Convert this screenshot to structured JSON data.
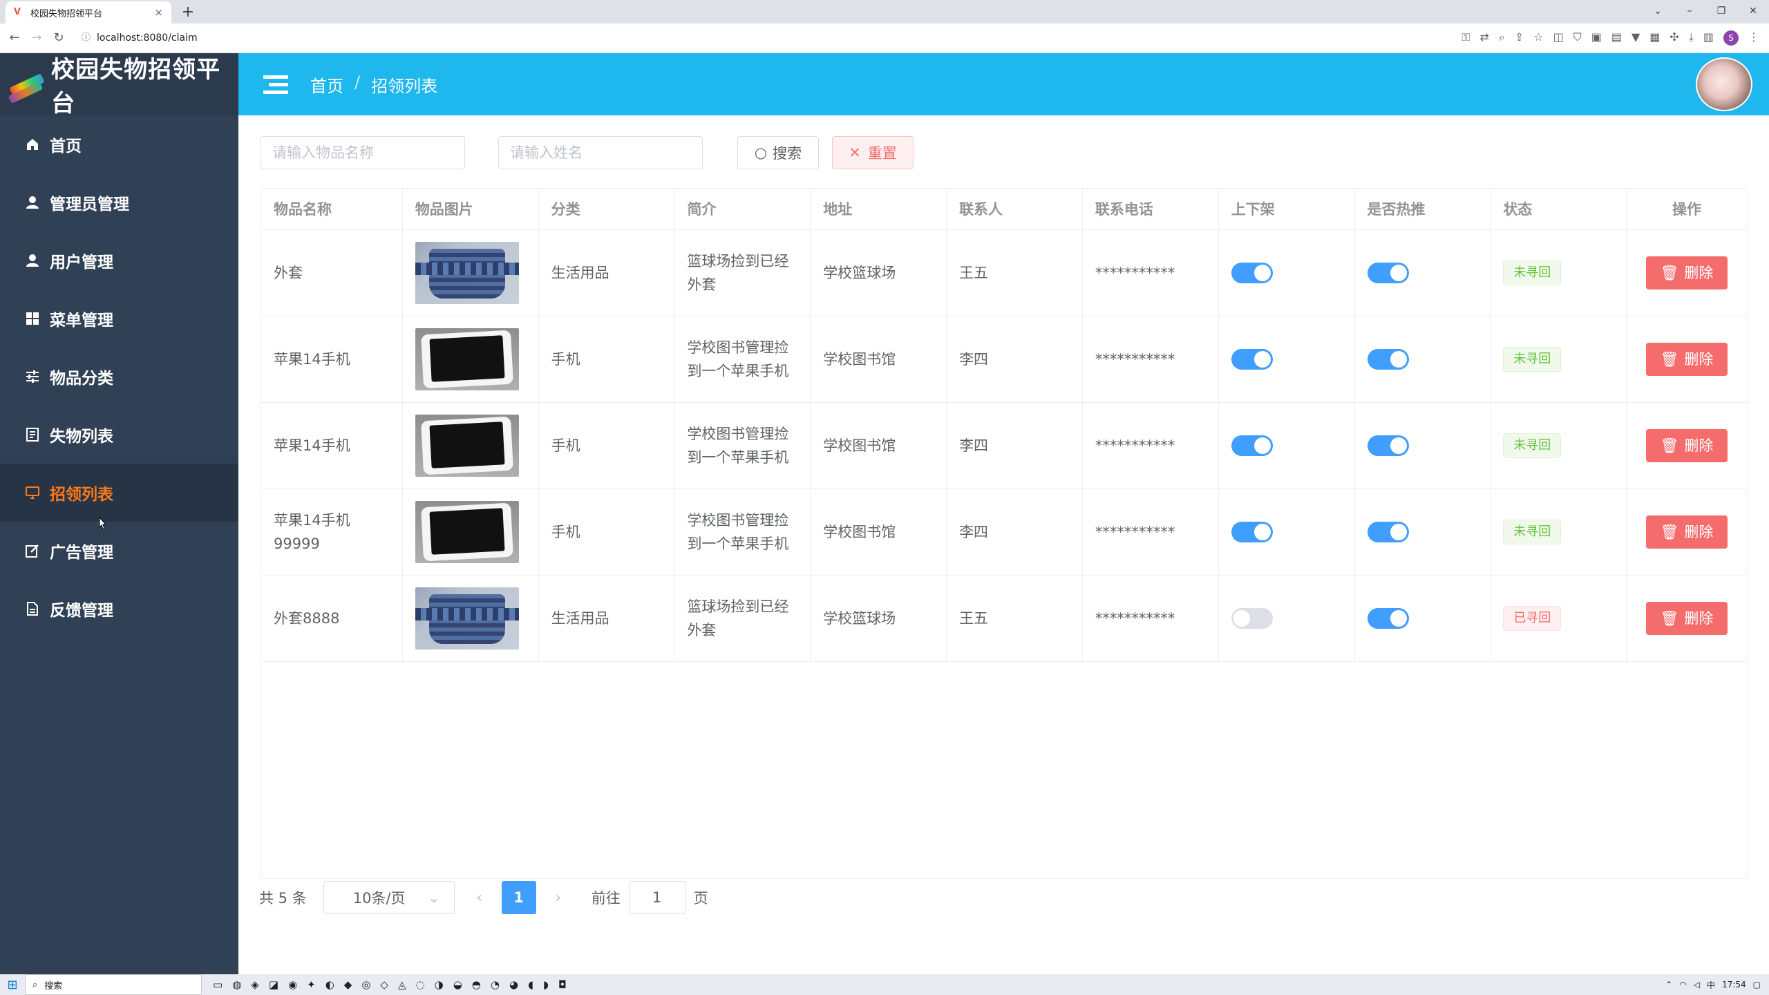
{
  "browser": {
    "tab_title": "校园失物招领平台",
    "tab_close": "×",
    "new_tab": "+",
    "url": "localhost:8080/claim",
    "profile": "S",
    "win_min": "–",
    "win_max": "❐",
    "win_close": "✕"
  },
  "sidebar": {
    "logo_text": "校园失物招领平台",
    "items": [
      {
        "label": "首页",
        "icon": "home-icon"
      },
      {
        "label": "管理员管理",
        "icon": "user-icon"
      },
      {
        "label": "用户管理",
        "icon": "user-icon"
      },
      {
        "label": "菜单管理",
        "icon": "grid-icon"
      },
      {
        "label": "物品分类",
        "icon": "sliders-icon"
      },
      {
        "label": "失物列表",
        "icon": "document-icon"
      },
      {
        "label": "招领列表",
        "icon": "monitor-icon",
        "active": true
      },
      {
        "label": "广告管理",
        "icon": "edit-icon"
      },
      {
        "label": "反馈管理",
        "icon": "file-icon"
      }
    ]
  },
  "header": {
    "breadcrumb_home": "首页",
    "breadcrumb_sep": "/",
    "breadcrumb_current": "招领列表"
  },
  "filters": {
    "item_name_placeholder": "请输入物品名称",
    "person_name_placeholder": "请输入姓名",
    "search_label": "搜索",
    "reset_label": "重置"
  },
  "table": {
    "columns": [
      "物品名称",
      "物品图片",
      "分类",
      "简介",
      "地址",
      "联系人",
      "联系电话",
      "上下架",
      "是否热推",
      "状态",
      "操作"
    ],
    "rows": [
      {
        "name": "外套",
        "image": "coat",
        "category": "生活用品",
        "intro": "篮球场捡到已经外套",
        "address": "学校篮球场",
        "contact": "王五",
        "phone": "***********",
        "listed": true,
        "hot": true,
        "status": "未寻回",
        "status_type": "green",
        "action": "删除"
      },
      {
        "name": "苹果14手机",
        "image": "phone",
        "category": "手机",
        "intro": "学校图书管理捡到一个苹果手机",
        "address": "学校图书馆",
        "contact": "李四",
        "phone": "***********",
        "listed": true,
        "hot": true,
        "status": "未寻回",
        "status_type": "green",
        "action": "删除"
      },
      {
        "name": "苹果14手机",
        "image": "phone",
        "category": "手机",
        "intro": "学校图书管理捡到一个苹果手机",
        "address": "学校图书馆",
        "contact": "李四",
        "phone": "***********",
        "listed": true,
        "hot": true,
        "status": "未寻回",
        "status_type": "green",
        "action": "删除"
      },
      {
        "name": "苹果14手机99999",
        "image": "phone",
        "category": "手机",
        "intro": "学校图书管理捡到一个苹果手机",
        "address": "学校图书馆",
        "contact": "李四",
        "phone": "***********",
        "listed": true,
        "hot": true,
        "status": "未寻回",
        "status_type": "green",
        "action": "删除"
      },
      {
        "name": "外套8888",
        "image": "coat",
        "category": "生活用品",
        "intro": "篮球场捡到已经外套",
        "address": "学校篮球场",
        "contact": "王五",
        "phone": "***********",
        "listed": false,
        "hot": true,
        "status": "已寻回",
        "status_type": "red",
        "action": "删除"
      }
    ]
  },
  "pagination": {
    "total_text": "共 5 条",
    "page_size": "10条/页",
    "current_page": "1",
    "goto_label": "前往",
    "goto_value": "1",
    "page_suffix": "页"
  },
  "taskbar": {
    "search_label": "搜索",
    "time": "17:54",
    "ime": "中"
  },
  "colors": {
    "header_bg": "#1eb7ee",
    "sidebar_bg": "#304156",
    "active_menu": "#ff7a1a",
    "primary": "#409eff",
    "danger": "#f56c6c"
  }
}
